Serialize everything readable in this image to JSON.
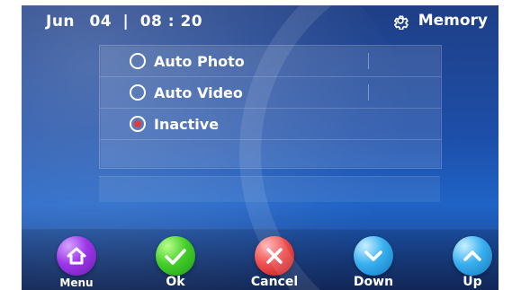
{
  "header": {
    "month": "Jun",
    "day": "04",
    "time": "08 : 20",
    "memory_label": "Memory",
    "icons": {
      "memory": "gear-icon"
    }
  },
  "options": [
    {
      "label": "Auto Photo",
      "selected": false
    },
    {
      "label": "Auto Video",
      "selected": false
    },
    {
      "label": "Inactive",
      "selected": true
    }
  ],
  "buttons": [
    {
      "label": "Menu",
      "icon": "home-icon",
      "color": "#9d36e8"
    },
    {
      "label": "Ok",
      "icon": "check-icon",
      "color": "#45cf2a"
    },
    {
      "label": "Cancel",
      "icon": "close-icon",
      "color": "#f04f4f"
    },
    {
      "label": "Down",
      "icon": "chevron-down-icon",
      "color": "#39b0f0"
    },
    {
      "label": "Up",
      "icon": "chevron-up-icon",
      "color": "#39b0f0"
    }
  ]
}
